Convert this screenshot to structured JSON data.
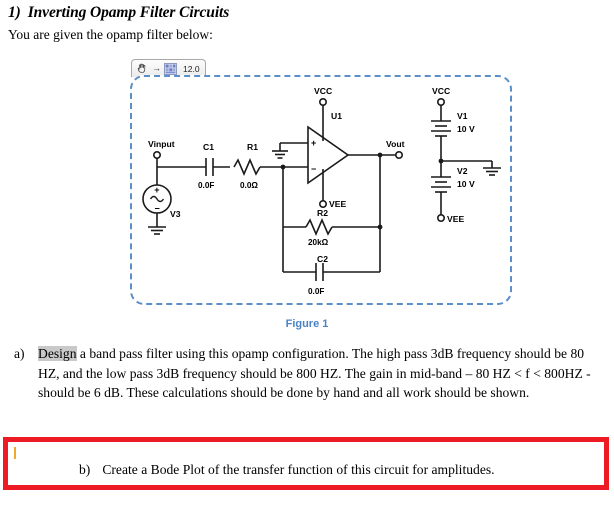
{
  "heading": {
    "number": "1)",
    "title": "Inverting Opamp Filter Circuits"
  },
  "intro": "You are given the opamp filter below:",
  "canvas_toolbar": {
    "pan_icon": "hand-icon",
    "arrow": "→",
    "grid_icon": "grid-icon",
    "zoom_value": "12.0"
  },
  "figure": {
    "caption": "Figure 1",
    "caption_color": "#4a82c4",
    "border_color": "#5b8fc9"
  },
  "circuit": {
    "nodes": {
      "vinput": "Vinput",
      "vout": "Vout",
      "vcc_left": "VCC",
      "vee_left": "VEE",
      "vcc_right": "VCC",
      "vee_right": "VEE"
    },
    "components": [
      {
        "ref": "V3",
        "value": "",
        "type": "ac-source"
      },
      {
        "ref": "C1",
        "value": "0.0F",
        "type": "capacitor"
      },
      {
        "ref": "R1",
        "value": "0.0Ω",
        "type": "resistor"
      },
      {
        "ref": "U1",
        "value": "",
        "type": "opamp"
      },
      {
        "ref": "R2",
        "value": "20kΩ",
        "type": "resistor"
      },
      {
        "ref": "C2",
        "value": "0.0F",
        "type": "capacitor"
      },
      {
        "ref": "V1",
        "value": "10 V",
        "type": "battery"
      },
      {
        "ref": "V2",
        "value": "10 V",
        "type": "battery"
      }
    ],
    "opamp_pins": {
      "plus": "+",
      "minus": "−"
    }
  },
  "items": {
    "a": {
      "marker": "a)",
      "word_selected": "Design",
      "text": " a band pass filter using this opamp configuration. The high pass 3dB frequency should be 80 HZ, and the low pass 3dB frequency should be 800 HZ. The gain in mid-band – 80 HZ < f < 800HZ - should be 6 dB. These calculations should be done by hand and all work should be shown."
    },
    "b": {
      "marker": "b)",
      "text": "Create a Bode Plot of the transfer function of this circuit for amplitudes.",
      "highlight_color": "#ed1c24"
    }
  }
}
